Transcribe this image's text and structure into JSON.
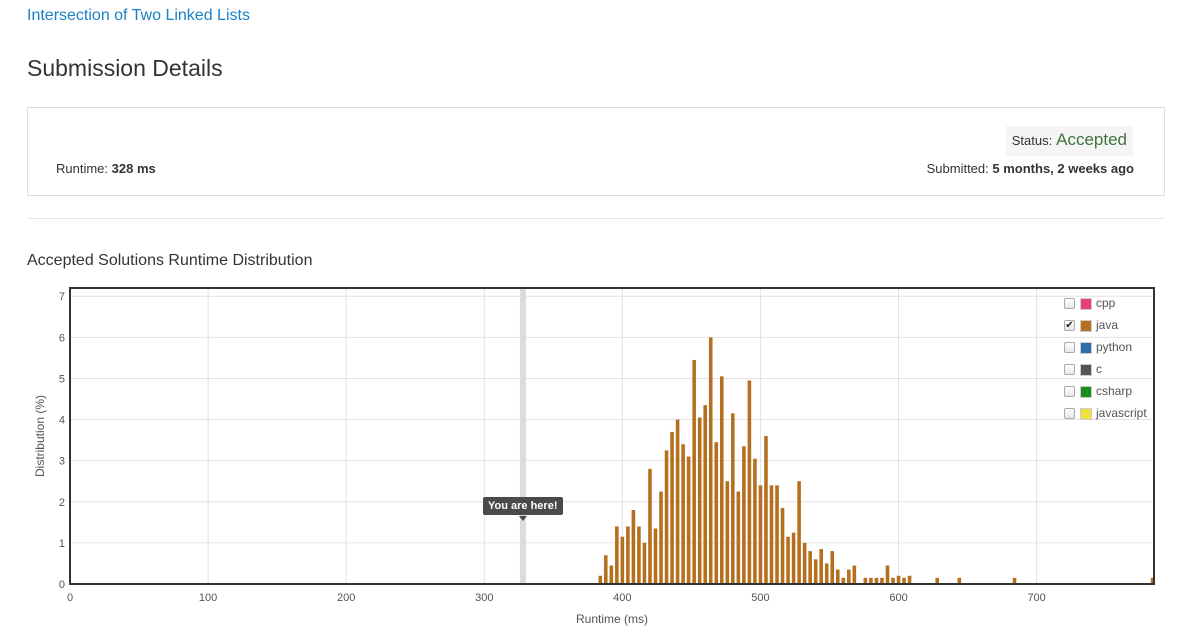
{
  "problem": {
    "link_text": "Intersection of Two Linked Lists"
  },
  "page": {
    "title": "Submission Details"
  },
  "details": {
    "status_label": "Status:",
    "status_value": "Accepted",
    "runtime_label": "Runtime:",
    "runtime_value": "328 ms",
    "submitted_label": "Submitted:",
    "submitted_value": "5 months, 2 weeks ago",
    "status_color": "#3c763d"
  },
  "chart_section": {
    "title": "Accepted Solutions Runtime Distribution"
  },
  "tooltip": {
    "text": "You are here!"
  },
  "legend": [
    {
      "label": "cpp",
      "color": "#e7407b",
      "checked": false
    },
    {
      "label": "java",
      "color": "#b5701f",
      "checked": true
    },
    {
      "label": "python",
      "color": "#2f6da8",
      "checked": false
    },
    {
      "label": "c",
      "color": "#555555",
      "checked": false
    },
    {
      "label": "csharp",
      "color": "#1d8a1d",
      "checked": false
    },
    {
      "label": "javascript",
      "color": "#f0e040",
      "checked": false
    }
  ],
  "chart_data": {
    "type": "bar",
    "title": "",
    "xlabel": "Runtime (ms)",
    "ylabel": "Distribution (%)",
    "xlim": [
      0,
      785
    ],
    "ylim": [
      0,
      7.2
    ],
    "xticks": [
      0,
      100,
      200,
      300,
      400,
      500,
      600,
      700
    ],
    "yticks": [
      0,
      1,
      2,
      3,
      4,
      5,
      6,
      7
    ],
    "grid": true,
    "legend_placement": "top-right",
    "marker": {
      "x": 328,
      "label": "You are here!"
    },
    "series": [
      {
        "name": "java",
        "color": "#b5701f",
        "x": [
          384,
          388,
          392,
          396,
          400,
          404,
          408,
          412,
          416,
          420,
          424,
          428,
          432,
          436,
          440,
          444,
          448,
          452,
          456,
          460,
          464,
          468,
          472,
          476,
          480,
          484,
          488,
          492,
          496,
          500,
          504,
          508,
          512,
          516,
          520,
          524,
          528,
          532,
          536,
          540,
          544,
          548,
          552,
          556,
          560,
          564,
          568,
          576,
          580,
          584,
          588,
          592,
          596,
          600,
          604,
          608,
          628,
          644,
          684,
          784
        ],
        "y": [
          0.2,
          0.7,
          0.45,
          1.4,
          1.15,
          1.4,
          1.8,
          1.4,
          1.0,
          2.8,
          1.35,
          2.25,
          3.25,
          3.7,
          4.0,
          3.4,
          3.1,
          5.45,
          4.05,
          4.35,
          6.0,
          3.45,
          5.05,
          2.5,
          4.15,
          2.25,
          3.35,
          4.95,
          3.05,
          2.4,
          3.6,
          2.4,
          2.4,
          1.85,
          1.15,
          1.25,
          2.5,
          1.0,
          0.8,
          0.6,
          0.85,
          0.5,
          0.8,
          0.35,
          0.15,
          0.35,
          0.45,
          0.15,
          0.15,
          0.15,
          0.15,
          0.45,
          0.15,
          0.2,
          0.15,
          0.2,
          0.15,
          0.15,
          0.15,
          0.15
        ]
      }
    ]
  }
}
